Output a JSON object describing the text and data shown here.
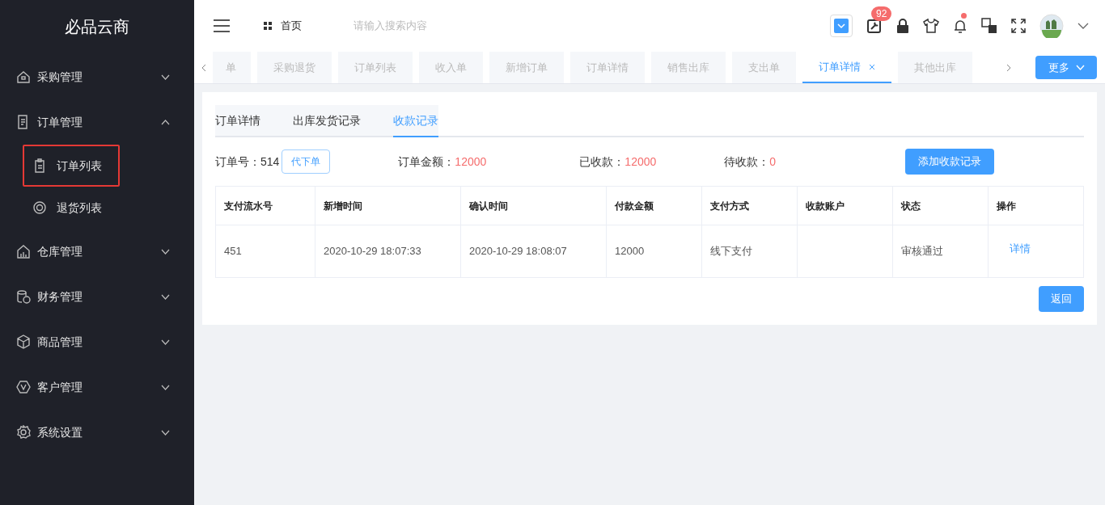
{
  "sidebar": {
    "logo": "必品云商",
    "items": [
      {
        "label": "采购管理",
        "expanded": false
      },
      {
        "label": "订单管理",
        "expanded": true,
        "children": [
          {
            "label": "订单列表",
            "selected": true
          },
          {
            "label": "退货列表",
            "selected": false
          }
        ]
      },
      {
        "label": "仓库管理",
        "expanded": false
      },
      {
        "label": "财务管理",
        "expanded": false
      },
      {
        "label": "商品管理",
        "expanded": false
      },
      {
        "label": "客户管理",
        "expanded": false
      },
      {
        "label": "系统设置",
        "expanded": false
      }
    ]
  },
  "header": {
    "breadcrumb": "首页",
    "search": {
      "placeholder": "请输入搜索内容"
    },
    "badge": "92"
  },
  "page_tabs": [
    {
      "label": "单",
      "selected": false
    },
    {
      "label": "采购退货",
      "selected": false
    },
    {
      "label": "订单列表",
      "selected": false
    },
    {
      "label": "收入单",
      "selected": false
    },
    {
      "label": "新增订单",
      "selected": false
    },
    {
      "label": "订单详情",
      "selected": false
    },
    {
      "label": "销售出库",
      "selected": false
    },
    {
      "label": "支出单",
      "selected": false
    },
    {
      "label": "订单详情",
      "selected": true
    },
    {
      "label": "其他出库",
      "selected": false
    }
  ],
  "more_button": "更多",
  "content_tabs": [
    {
      "label": "订单详情",
      "selected": false
    },
    {
      "label": "出库发货记录",
      "selected": false
    },
    {
      "label": "收款记录",
      "selected": true
    }
  ],
  "summary": {
    "order_no_label": "订单号：",
    "order_no": "514",
    "proxy_button": "代下单",
    "fields": [
      {
        "label": "订单金额：",
        "value": "12000"
      },
      {
        "label": "已收款：",
        "value": "12000"
      },
      {
        "label": "待收款：",
        "value": "0"
      }
    ],
    "add_button": "添加收款记录"
  },
  "table": {
    "columns": [
      "支付流水号",
      "新增时间",
      "确认时间",
      "付款金额",
      "支付方式",
      "收款账户",
      "状态",
      "操作"
    ],
    "rows": [
      {
        "cells": [
          "451",
          "2020-10-29 18:07:33",
          "2020-10-29 18:08:07",
          "12000",
          "线下支付",
          "",
          "审核通过"
        ],
        "action": "详情"
      }
    ]
  },
  "back_button": "返回"
}
